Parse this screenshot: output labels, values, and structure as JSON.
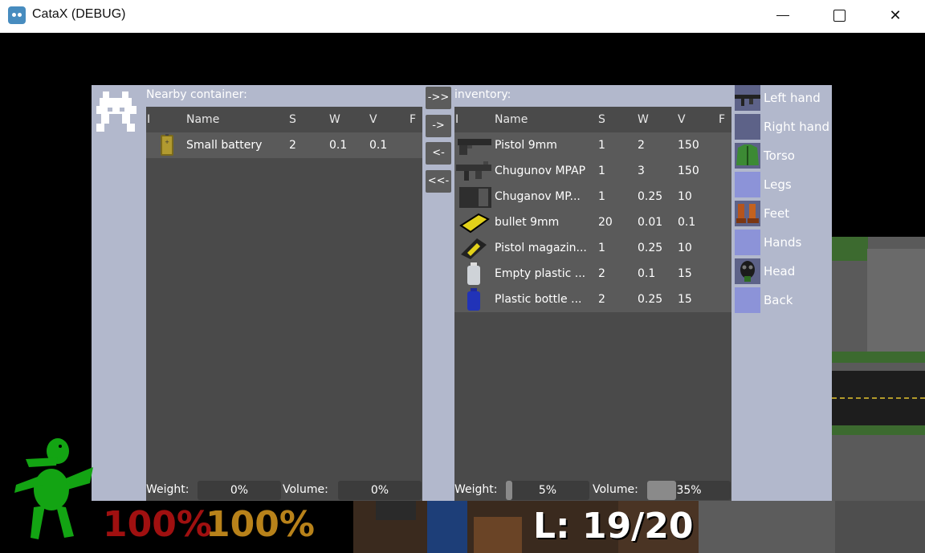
{
  "window": {
    "title": "CataX (DEBUG)"
  },
  "container": {
    "header": "Nearby container:",
    "columns": [
      "I",
      "Name",
      "S",
      "W",
      "V",
      "F"
    ],
    "rows": [
      {
        "icon": "battery-icon",
        "name": "Small battery",
        "s": "2",
        "w": "0.1",
        "v": "0.1"
      }
    ],
    "footer": {
      "weight_label": "Weight:",
      "weight_value": "0%",
      "volume_label": "Volume:",
      "volume_value": "0%"
    }
  },
  "transfer": {
    "all_right": "->>",
    "right": "->",
    "left": "<-",
    "all_left": "<<-"
  },
  "inventory": {
    "header": "inventory:",
    "columns": [
      "I",
      "Name",
      "S",
      "W",
      "V",
      "F"
    ],
    "rows": [
      {
        "icon": "pistol-icon",
        "name": "Pistol 9mm",
        "s": "1",
        "w": "2",
        "v": "150"
      },
      {
        "icon": "rifle-icon",
        "name": "Chugunov MPAP",
        "s": "1",
        "w": "3",
        "v": "150"
      },
      {
        "icon": "magazine-icon",
        "name": "Chuganov MP...",
        "s": "1",
        "w": "0.25",
        "v": "10"
      },
      {
        "icon": "bullet-icon",
        "name": "bullet 9mm",
        "s": "20",
        "w": "0.01",
        "v": "0.1"
      },
      {
        "icon": "pistol-magazine-icon",
        "name": "Pistol magazin...",
        "s": "1",
        "w": "0.25",
        "v": "10"
      },
      {
        "icon": "empty-bottle-icon",
        "name": "Empty plastic ...",
        "s": "2",
        "w": "0.1",
        "v": "15"
      },
      {
        "icon": "bottle-icon",
        "name": "Plastic bottle ...",
        "s": "2",
        "w": "0.25",
        "v": "15"
      }
    ],
    "footer": {
      "weight_label": "Weight:",
      "weight_value": "5%",
      "weight_fill": 0.05,
      "volume_label": "Volume:",
      "volume_value": "35%",
      "volume_fill": 0.35
    }
  },
  "equipment": [
    {
      "label": "Left hand",
      "icon": "rifle-icon"
    },
    {
      "label": "Right hand",
      "icon": "empty-slot-icon"
    },
    {
      "label": "Torso",
      "icon": "jacket-icon"
    },
    {
      "label": "Legs",
      "icon": "empty-slot-icon"
    },
    {
      "label": "Feet",
      "icon": "boots-icon"
    },
    {
      "label": "Hands",
      "icon": "empty-slot-icon"
    },
    {
      "label": "Head",
      "icon": "gas-mask-icon"
    },
    {
      "label": "Back",
      "icon": "empty-slot-icon"
    }
  ],
  "hud": {
    "health": "100%",
    "stamina": "100%",
    "level": "L: 19/20",
    "health_color": "#a01010",
    "stamina_color": "#b8821a"
  }
}
